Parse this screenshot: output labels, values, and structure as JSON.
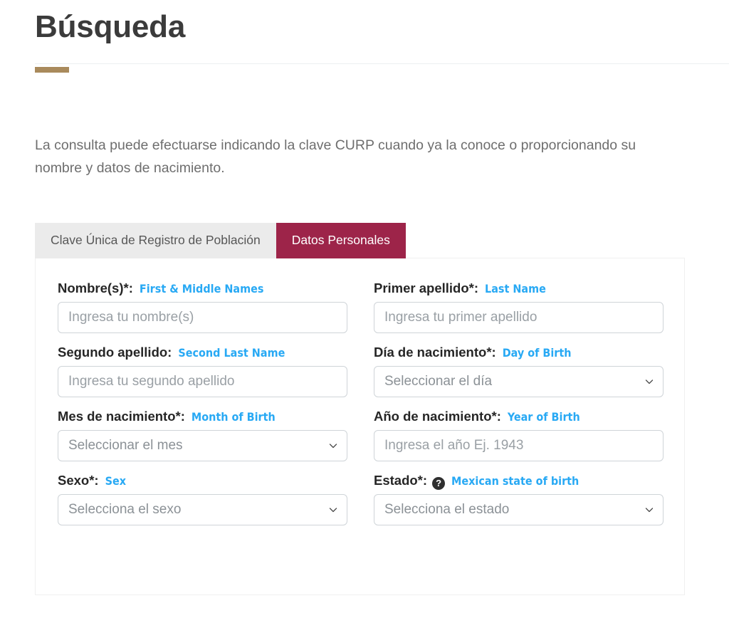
{
  "page": {
    "title": "Búsqueda",
    "intro": "La consulta puede efectuarse indicando la clave CURP cuando ya la conoce o proporcionando su nombre y datos de nacimiento.",
    "accent_color": "#a98a5c",
    "brand_color": "#9d2449",
    "annotation_color": "#28a9f4"
  },
  "tabs": [
    {
      "label": "Clave Única de Registro de Población",
      "active": false
    },
    {
      "label": "Datos Personales",
      "active": true
    }
  ],
  "form": {
    "fields": [
      {
        "name": "nombres",
        "label_es": "Nombre(s)*:",
        "label_en": "First & Middle Names",
        "type": "text",
        "placeholder": "Ingresa tu nombre(s)",
        "value": "",
        "column": "left"
      },
      {
        "name": "primer-apellido",
        "label_es": "Primer apellido*:",
        "label_en": "Last Name",
        "type": "text",
        "placeholder": "Ingresa tu primer apellido",
        "value": "",
        "column": "right"
      },
      {
        "name": "segundo-apellido",
        "label_es": "Segundo apellido:",
        "label_en": "Second Last Name",
        "type": "text",
        "placeholder": "Ingresa tu segundo apellido",
        "value": "",
        "column": "left"
      },
      {
        "name": "dia-nacimiento",
        "label_es": "Día de nacimiento*:",
        "label_en": "Day of Birth",
        "type": "select",
        "selected": "Seleccionar el día",
        "column": "right"
      },
      {
        "name": "mes-nacimiento",
        "label_es": "Mes de nacimiento*:",
        "label_en": "Month of Birth",
        "type": "select",
        "selected": "Seleccionar el mes",
        "column": "left"
      },
      {
        "name": "anio-nacimiento",
        "label_es": "Año de nacimiento*:",
        "label_en": "Year of Birth",
        "type": "text",
        "placeholder": "Ingresa el año Ej. 1943",
        "value": "",
        "column": "right"
      },
      {
        "name": "sexo",
        "label_es": "Sexo*:",
        "label_en": "Sex",
        "type": "select",
        "selected": "Selecciona el sexo",
        "column": "left"
      },
      {
        "name": "estado",
        "label_es": "Estado*:",
        "label_en": "Mexican state of birth",
        "type": "select",
        "selected": "Selecciona el estado",
        "column": "right",
        "help_icon": "help-circle-icon",
        "help_glyph": "?"
      }
    ]
  }
}
